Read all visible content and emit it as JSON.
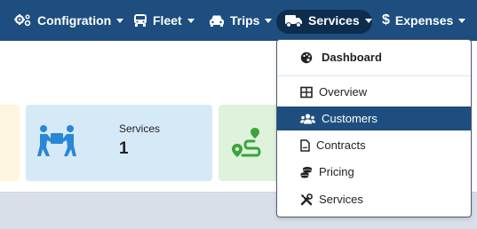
{
  "navbar": {
    "items": [
      {
        "label": "Configration",
        "icon": "cogs-icon"
      },
      {
        "label": "Fleet",
        "icon": "bus-icon"
      },
      {
        "label": "Trips",
        "icon": "car-icon"
      },
      {
        "label": "Services",
        "icon": "truck-icon"
      },
      {
        "label": "Expenses",
        "icon": "dollar-icon"
      }
    ],
    "active_index": 3,
    "color": "#1d4e7f",
    "active_color": "#0d2d4f"
  },
  "dropdown": {
    "header": {
      "label": "Dashboard",
      "icon": "palette-icon"
    },
    "items": [
      {
        "label": "Overview",
        "icon": "table-icon"
      },
      {
        "label": "Customers",
        "icon": "users-icon",
        "active": true
      },
      {
        "label": "Contracts",
        "icon": "file-contract-icon"
      },
      {
        "label": "Pricing",
        "icon": "coins-icon"
      },
      {
        "label": "Services",
        "icon": "tools-icon"
      }
    ]
  },
  "cards": {
    "services": {
      "label": "Services",
      "value": "1",
      "icon": "people-carry-icon",
      "color": "#d6e9f6"
    },
    "route": {
      "icon": "route-icon",
      "color": "#dff2dc"
    },
    "left": {
      "color": "#fdf5dd"
    }
  }
}
